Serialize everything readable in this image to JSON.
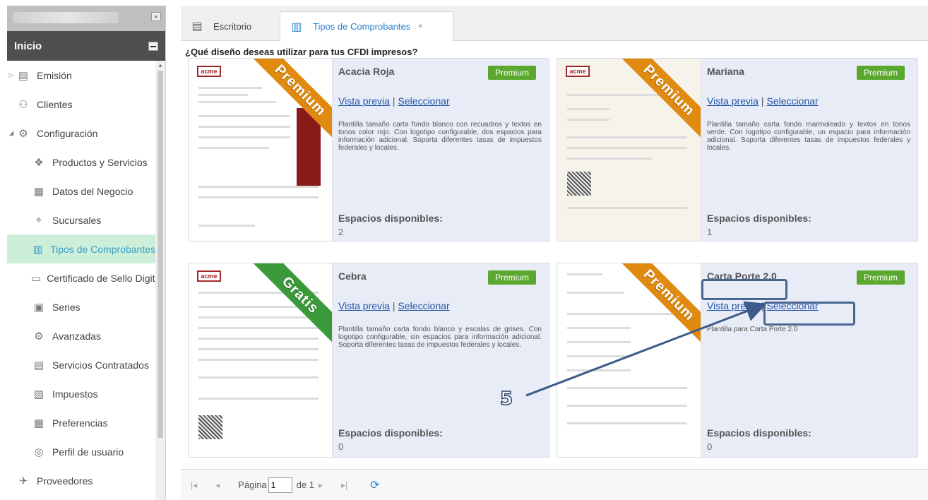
{
  "sidebar": {
    "header": "Inicio",
    "items": [
      {
        "label": "Emisión",
        "icon": "emision-icon",
        "level": 0,
        "arrow": "▷"
      },
      {
        "label": "Clientes",
        "icon": "clients-icon",
        "level": 0,
        "arrow": ""
      },
      {
        "label": "Configuración",
        "icon": "config-icon",
        "level": 0,
        "arrow": "◢"
      },
      {
        "label": "Productos y Servicios",
        "icon": "products-icon",
        "level": 1
      },
      {
        "label": "Datos del Negocio",
        "icon": "business-icon",
        "level": 1
      },
      {
        "label": "Sucursales",
        "icon": "branch-icon",
        "level": 1
      },
      {
        "label": "Tipos de Comprobantes",
        "icon": "receipt-types-icon",
        "level": 1,
        "active": true
      },
      {
        "label": "Certificado de Sello Digital",
        "icon": "certificate-icon",
        "level": 1
      },
      {
        "label": "Series",
        "icon": "series-icon",
        "level": 1
      },
      {
        "label": "Avanzadas",
        "icon": "advanced-icon",
        "level": 1
      },
      {
        "label": "Servicios Contratados",
        "icon": "services-icon",
        "level": 1
      },
      {
        "label": "Impuestos",
        "icon": "taxes-icon",
        "level": 1
      },
      {
        "label": "Preferencias",
        "icon": "preferences-icon",
        "level": 1
      },
      {
        "label": "Perfil de usuario",
        "icon": "user-profile-icon",
        "level": 1
      },
      {
        "label": "Proveedores",
        "icon": "suppliers-icon",
        "level": 0
      }
    ]
  },
  "tabs": [
    {
      "label": "Escritorio",
      "icon": "desktop-icon"
    },
    {
      "label": "Tipos de Comprobantes",
      "icon": "receipt-types-icon",
      "active": true
    }
  ],
  "main": {
    "question": "¿Qué diseño deseas utilizar para tus CFDI impresos?",
    "cards": [
      {
        "title": "Acacia Roja",
        "badge": "Premium",
        "ribbon": "Premium",
        "preview_label": "Vista previa",
        "select_label": "Seleccionar",
        "description": "Plantilla tamaño carta fondo blanco con recuadros y textos en tonos color rojo. Con logotipo configurable, dos espacios para información adicional. Soporta diferentes tasas de impuestos federales y locales.",
        "spaces_label": "Espacios disponibles:",
        "spaces_value": "2"
      },
      {
        "title": "Mariana",
        "badge": "Premium",
        "ribbon": "Premium",
        "preview_label": "Vista previa",
        "select_label": "Seleccionar",
        "description": "Plantilla tamaño carta fondo marmoleado y textos en tonos verde. Con logotipo configurable, un espacio para información adicional. Soporta diferentes tasas de impuestos federales y locales.",
        "spaces_label": "Espacios disponibles:",
        "spaces_value": "1"
      },
      {
        "title": "Cebra",
        "badge": "Premium",
        "ribbon": "Gratis",
        "preview_label": "Vista previa",
        "select_label": "Seleccionar",
        "description": "Plantilla tamaño carta fondo blanco y escalas de grises. Con logotipo configurable, sin espacios para información adicional. Soporta diferentes tasas de impuestos federales y locales.",
        "spaces_label": "Espacios disponibles:",
        "spaces_value": "0"
      },
      {
        "title": "Carta Porte 2.0",
        "badge": "Premium",
        "ribbon": "Premium",
        "preview_label": "Vista previa",
        "select_label": "Seleccionar",
        "description": "Plantilla para Carta Porte 2.0",
        "spaces_label": "Espacios disponibles:",
        "spaces_value": "0"
      }
    ]
  },
  "pager": {
    "page_label": "Página",
    "page_value": "1",
    "of_label": "de 1"
  },
  "annotation": {
    "step": "5"
  },
  "colors": {
    "accent_blue": "#2a7fc9",
    "badge_green": "#5aa82e",
    "ribbon_orange": "#e08a10",
    "ribbon_green": "#3a9a3a",
    "active_item_bg": "#cdeed8",
    "annotation_blue": "#4a6690"
  }
}
